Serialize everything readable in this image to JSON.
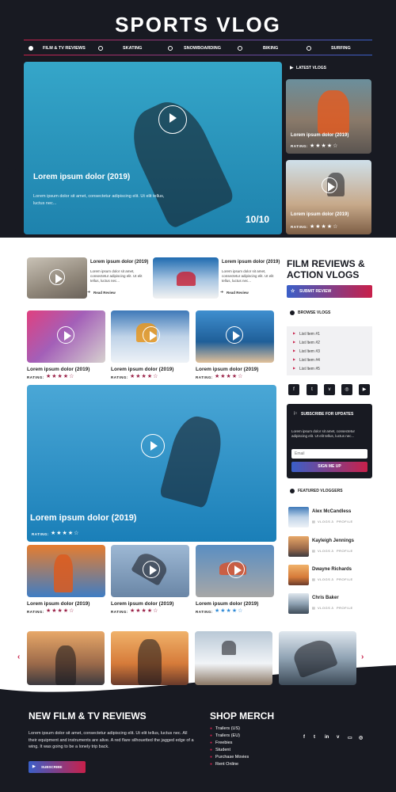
{
  "site_title": "SPORTS VLOG",
  "nav": [
    "FILM & TV REVIEWS",
    "SKATING",
    "SNOWBOARDING",
    "BIKING",
    "SURFING"
  ],
  "hero": {
    "title": "Lorem ipsum dolor (2019)",
    "text": "Lorem ipsum dolor sit amet, consectetur adipiscing elit. Ut elit tellus, luctus nec...",
    "score": "10/10"
  },
  "latest": {
    "heading": "LATEST VLOGS",
    "items": [
      {
        "title": "Lorem ipsum dolor (2019)",
        "rating_label": "RATING:",
        "stars": "★★★★☆"
      },
      {
        "title": "Lorem ipsum dolor (2019)",
        "rating_label": "RATING:",
        "stars": "★★★★☆"
      }
    ]
  },
  "reviews": [
    {
      "title": "Lorem ipsum dolor (2019)",
      "text": "Lorem ipsum dolor sit amet, consectetur adipiscing elit. Ut elit tellus, luctus nec...",
      "link": "Read Review"
    },
    {
      "title": "Lorem ipsum dolor (2019)",
      "text": "Lorem ipsum dolor sit amet, consectetur adipiscing elit. Ut elit tellus, luctus nec...",
      "link": "Read Review"
    }
  ],
  "grid_row1": [
    {
      "title": "Lorem ipsum dolor (2019)",
      "rating_label": "RATING:",
      "stars": "★★★★☆"
    },
    {
      "title": "Lorem ipsum dolor (2019)",
      "rating_label": "RATING:",
      "stars": "★★★★☆"
    },
    {
      "title": "Lorem ipsum dolor (2019)",
      "rating_label": "RATING:",
      "stars": "★★★★☆"
    }
  ],
  "feature": {
    "title": "Lorem ipsum dolor (2019)",
    "rating_label": "RATING:",
    "stars": "★★★★☆"
  },
  "grid_row2": [
    {
      "title": "Lorem ipsum dolor (2019)",
      "rating_label": "RATING:",
      "stars": "★★★★☆"
    },
    {
      "title": "Lorem ipsum dolor (2019)",
      "rating_label": "RATING:",
      "stars": "★★★★☆"
    },
    {
      "title": "Lorem ipsum dolor (2019)",
      "rating_label": "RATING:",
      "stars": "★★★★☆"
    }
  ],
  "sidebar": {
    "heading": "FILM REVIEWS & ACTION VLOGS",
    "submit_button": "SUBMIT REVIEW",
    "browse_heading": "BROWSE VLOGS",
    "list_items": [
      "List Item #1",
      "List Item #2",
      "List Item #3",
      "List Item #4",
      "List Item #5"
    ],
    "social": [
      "f",
      "t",
      "v",
      "◎",
      "▶"
    ],
    "subscribe": {
      "heading": "SUBSCRIBE FOR UPDATES",
      "text": "Lorem ipsum dolor sit amet, consectetur adipiscing elit. Ut elit tellus, luctus nec...",
      "email_placeholder": "Email",
      "button": "SIGN ME UP"
    },
    "featured_heading": "FEATURED VLOGGERS",
    "vloggers": [
      {
        "name": "Alex McCandless",
        "vlogs": "VLOGS",
        "profile": "PROFILE"
      },
      {
        "name": "Kayleigh Jennings",
        "vlogs": "VLOGS",
        "profile": "PROFILE"
      },
      {
        "name": "Dwayne Richards",
        "vlogs": "VLOGS",
        "profile": "PROFILE"
      },
      {
        "name": "Chris Baker",
        "vlogs": "VLOGS",
        "profile": "PROFILE"
      }
    ]
  },
  "footer": {
    "reviews_heading": "NEW FILM & TV REVIEWS",
    "reviews_text": "Lorem ipsum dolor sit amet, consectetur adipiscing elit. Ut elit tellus, luctus nec. All their equipment and instruments are alive. A red flare silhouetted the jagged edge of a wing. It was going to be a lonely trip back.",
    "subscribe_button": "SUBSCRIBE",
    "merch_heading": "SHOP MERCH",
    "merch_links": [
      "Trailers (US)",
      "Trailers (EU)",
      "Freebies",
      "Student",
      "Purchase Movies",
      "Rent Online"
    ],
    "social": [
      "f",
      "t",
      "in",
      "v",
      "▭",
      "◎"
    ]
  },
  "colors": {
    "accent": "#c8204a",
    "brand_blue": "#3a5fc8",
    "dark": "#181a22"
  }
}
